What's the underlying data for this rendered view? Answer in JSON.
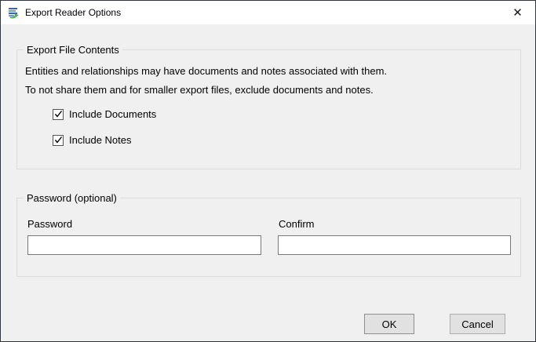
{
  "window": {
    "title": "Export Reader Options",
    "close_glyph": "✕"
  },
  "groups": {
    "contents": {
      "legend": "Export File Contents",
      "description_line1": "Entities and relationships may have documents and notes associated with them.",
      "description_line2": "To not share them and for smaller export files, exclude documents and notes.",
      "checkboxes": [
        {
          "label": "Include Documents",
          "checked": true
        },
        {
          "label": "Include Notes",
          "checked": true
        }
      ]
    },
    "password": {
      "legend": "Password (optional)",
      "fields": [
        {
          "label": "Password",
          "value": ""
        },
        {
          "label": "Confirm",
          "value": ""
        }
      ]
    }
  },
  "buttons": {
    "ok": "OK",
    "cancel": "Cancel"
  },
  "colors": {
    "titlebar_bg": "#ffffff",
    "client_bg": "#f0f0f0",
    "window_border": "#31363c",
    "groupbox_border": "#dcdcdc",
    "button_bg": "#e1e1e1",
    "button_border": "#adadad",
    "input_border": "#7a7a7a",
    "icon_blue": "#3a66b0",
    "icon_light_blue": "#6aa0d8",
    "icon_green": "#4caf50"
  }
}
